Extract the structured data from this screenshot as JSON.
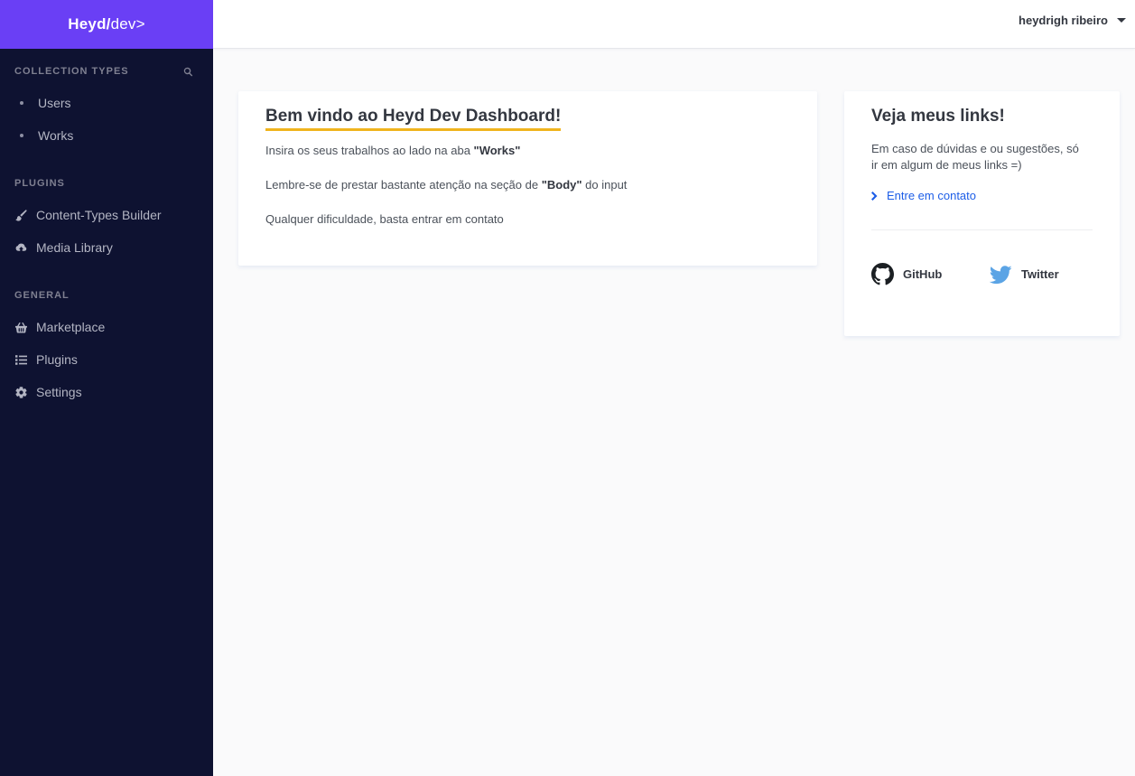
{
  "brand": {
    "bold": "Heyd/",
    "light": "dev>"
  },
  "sidebar": {
    "collection_title": "COLLECTION TYPES",
    "collection_items": [
      {
        "label": "Users"
      },
      {
        "label": "Works"
      }
    ],
    "plugins_title": "PLUGINS",
    "plugins_items": [
      {
        "label": "Content-Types Builder",
        "icon": "paintbrush-icon"
      },
      {
        "label": "Media Library",
        "icon": "cloud-upload-icon"
      }
    ],
    "general_title": "GENERAL",
    "general_items": [
      {
        "label": "Marketplace",
        "icon": "basket-icon"
      },
      {
        "label": "Plugins",
        "icon": "list-icon"
      },
      {
        "label": "Settings",
        "icon": "gear-icon"
      }
    ]
  },
  "header": {
    "user_name": "heydrigh ribeiro"
  },
  "welcome": {
    "title": "Bem vindo ao Heyd Dev Dashboard!",
    "line1_pre": "Insira os seus trabalhos ao lado na aba ",
    "line1_bold": "\"Works\"",
    "line2_pre": "Lembre-se de prestar bastante atenção na seção de ",
    "line2_bold": "\"Body\"",
    "line2_post": " do input",
    "line3": "Qualquer dificuldade, basta entrar em contato"
  },
  "links": {
    "title": "Veja meus links!",
    "description": "Em caso de dúvidas e ou sugestões, só ir em algum de meus links =)",
    "contact_label": "Entre em contato",
    "github_label": "GitHub",
    "twitter_label": "Twitter"
  },
  "colors": {
    "brand_purple": "#6a3ff5",
    "sidebar_bg": "#0e1231",
    "accent_yellow": "#f0b41e",
    "link_blue": "#1c5de7",
    "twitter_blue": "#5ba4e5"
  }
}
